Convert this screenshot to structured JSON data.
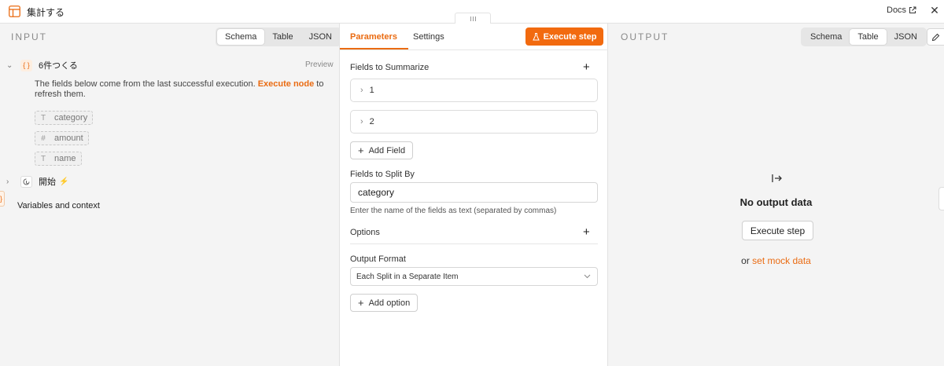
{
  "header": {
    "title": "集計する",
    "docs_label": "Docs",
    "close_glyph": "✕"
  },
  "input": {
    "label": "INPUT",
    "tabs": [
      "Schema",
      "Table",
      "JSON"
    ],
    "active_tab": "Schema",
    "node": {
      "name": "6件つくる",
      "preview_label": "Preview",
      "icon_glyph": "{ }"
    },
    "info": {
      "prefix": "The fields below come from the last successful execution.",
      "link": "Execute node",
      "suffix": "to refresh them."
    },
    "fields": [
      {
        "type_glyph": "T",
        "name": "category"
      },
      {
        "type_glyph": "#",
        "name": "amount"
      },
      {
        "type_glyph": "T",
        "name": "name"
      }
    ],
    "trigger_node": {
      "name": "開始",
      "bolt_glyph": "⚡"
    },
    "variables_label": "Variables and context"
  },
  "middle": {
    "tabs": [
      "Parameters",
      "Settings"
    ],
    "active_tab": "Parameters",
    "execute_label": "Execute step",
    "fields_to_summarize_label": "Fields to Summarize",
    "summarize_items": [
      "1",
      "2"
    ],
    "add_field_label": "Add Field",
    "fields_split_label": "Fields to Split By",
    "fields_split_value": "category",
    "fields_split_hint": "Enter the name of the fields as text (separated by commas)",
    "options_label": "Options",
    "output_format_label": "Output Format",
    "output_format_value": "Each Split in a Separate Item",
    "add_option_label": "Add option"
  },
  "output": {
    "label": "OUTPUT",
    "tabs": [
      "Schema",
      "Table",
      "JSON"
    ],
    "active_tab": "Table",
    "no_output_title": "No output data",
    "execute_label": "Execute step",
    "mock_prefix": "or",
    "mock_link": "set mock data"
  },
  "colors": {
    "accent": "#f26a0f",
    "link": "#ea6b12",
    "panel_bg": "#f4f4f4"
  }
}
